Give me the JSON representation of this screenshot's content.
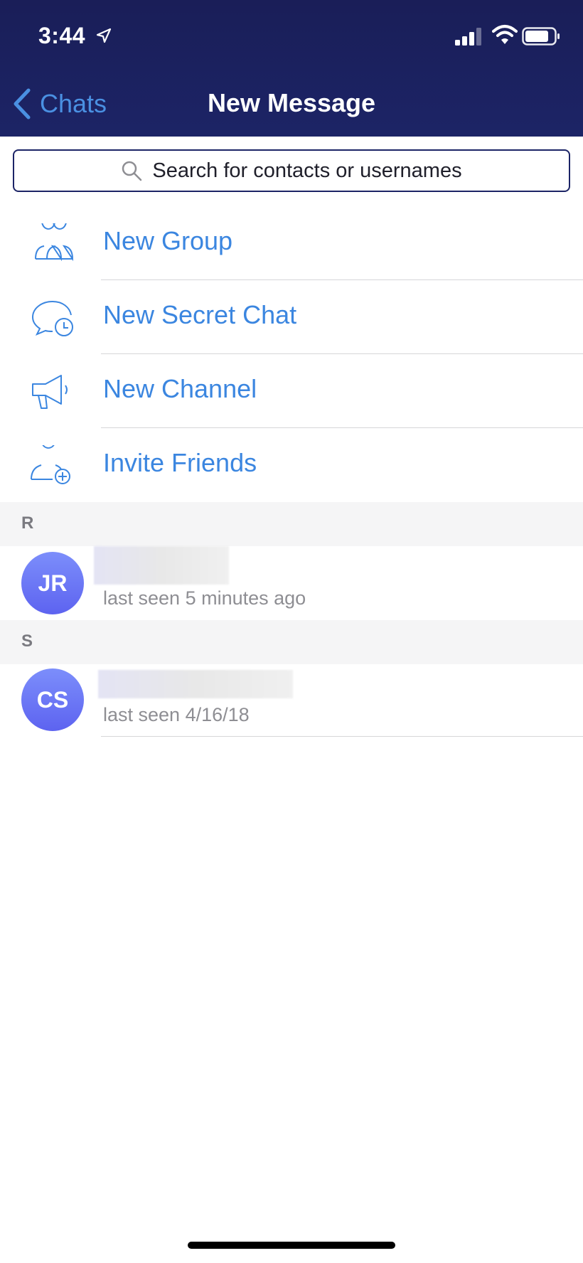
{
  "status_bar": {
    "time": "3:44"
  },
  "nav": {
    "back_label": "Chats",
    "title": "New Message"
  },
  "search": {
    "placeholder": "Search for contacts or usernames"
  },
  "actions": [
    {
      "label": "New Group",
      "icon": "group-icon"
    },
    {
      "label": "New Secret Chat",
      "icon": "secret-chat-icon"
    },
    {
      "label": "New Channel",
      "icon": "megaphone-icon"
    },
    {
      "label": "Invite Friends",
      "icon": "invite-person-icon"
    }
  ],
  "sections": [
    {
      "letter": "R",
      "contacts": [
        {
          "initials": "JR",
          "status": "last seen 5 minutes ago"
        }
      ]
    },
    {
      "letter": "S",
      "contacts": [
        {
          "initials": "CS",
          "status": "last seen 4/16/18"
        }
      ]
    }
  ],
  "colors": {
    "header_bg": "#1c2466",
    "accent": "#3b86e0",
    "avatar_gradient_top": "#7c8efb",
    "avatar_gradient_bottom": "#5d63f0",
    "secondary_text": "#8e8e93"
  }
}
